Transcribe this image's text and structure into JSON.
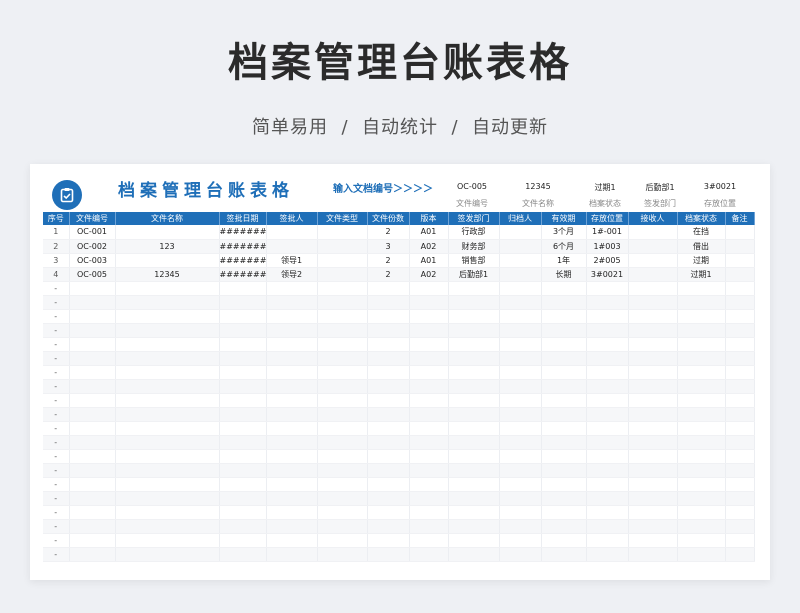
{
  "hero": {
    "title": "档案管理台账表格",
    "subtitle": "简单易用  /  自动统计  /  自动更新"
  },
  "sheet": {
    "title": "档案管理台账表格",
    "input_hint": "输入文档编号＞＞＞＞",
    "lookup": {
      "row1": [
        "OC-005",
        "12345",
        "过期1",
        "后勤部1",
        "3#0021"
      ],
      "row2": [
        "文件编号",
        "文件名称",
        "档案状态",
        "签发部门",
        "存放位置"
      ]
    }
  },
  "table": {
    "headers": [
      "序号",
      "文件编号",
      "文件名称",
      "签批日期",
      "签批人",
      "文件类型",
      "文件份数",
      "版本",
      "签发部门",
      "归档人",
      "有效期",
      "存放位置",
      "接收人",
      "档案状态",
      "备注"
    ],
    "rows": [
      [
        "1",
        "OC-001",
        "",
        "#########",
        "",
        "",
        "2",
        "A01",
        "行政部",
        "",
        "3个月",
        "1#-001",
        "",
        "在挡",
        ""
      ],
      [
        "2",
        "OC-002",
        "123",
        "#########",
        "",
        "",
        "3",
        "A02",
        "财务部",
        "",
        "6个月",
        "1#003",
        "",
        "借出",
        ""
      ],
      [
        "3",
        "OC-003",
        "",
        "#########",
        "领导1",
        "",
        "2",
        "A01",
        "销售部",
        "",
        "1年",
        "2#005",
        "",
        "过期",
        ""
      ],
      [
        "4",
        "OC-005",
        "12345",
        "#########",
        "领导2",
        "",
        "2",
        "A02",
        "后勤部1",
        "",
        "长期",
        "3#0021",
        "",
        "过期1",
        ""
      ],
      [
        "-"
      ],
      [
        "-"
      ],
      [
        "-"
      ],
      [
        "-"
      ],
      [
        "-"
      ],
      [
        "-"
      ],
      [
        "-"
      ],
      [
        "-"
      ],
      [
        "-"
      ],
      [
        "-"
      ],
      [
        "-"
      ],
      [
        "-"
      ],
      [
        "-"
      ],
      [
        "-"
      ],
      [
        "-"
      ],
      [
        "-"
      ],
      [
        "-"
      ],
      [
        "-"
      ],
      [
        "-"
      ],
      [
        "-"
      ]
    ]
  }
}
